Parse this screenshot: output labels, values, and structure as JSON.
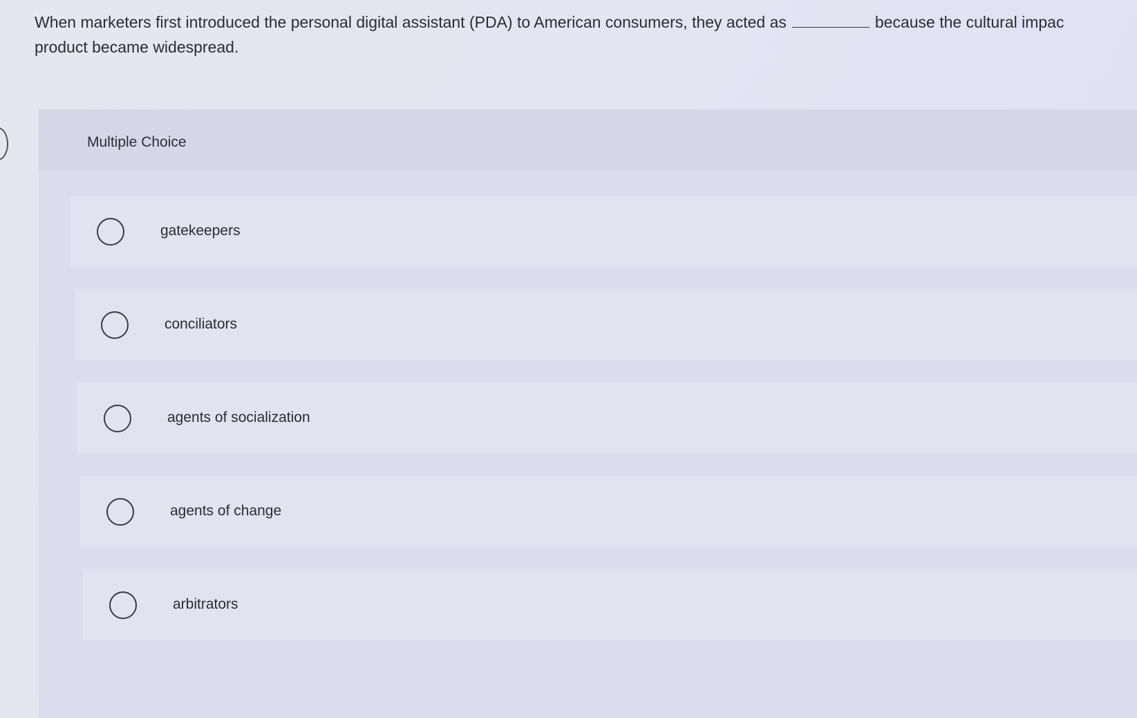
{
  "question": {
    "line1_before_blank": "When marketers first introduced the personal digital assistant (PDA) to American consumers, they acted as",
    "line1_after_blank": "because the cultural impac",
    "line2": "product became widespread."
  },
  "multiple_choice": {
    "heading": "Multiple Choice",
    "options": [
      {
        "label": "gatekeepers",
        "selected": false
      },
      {
        "label": "conciliators",
        "selected": false
      },
      {
        "label": "agents of socialization",
        "selected": false
      },
      {
        "label": "agents of change",
        "selected": false
      },
      {
        "label": "arbitrators",
        "selected": false
      }
    ]
  }
}
